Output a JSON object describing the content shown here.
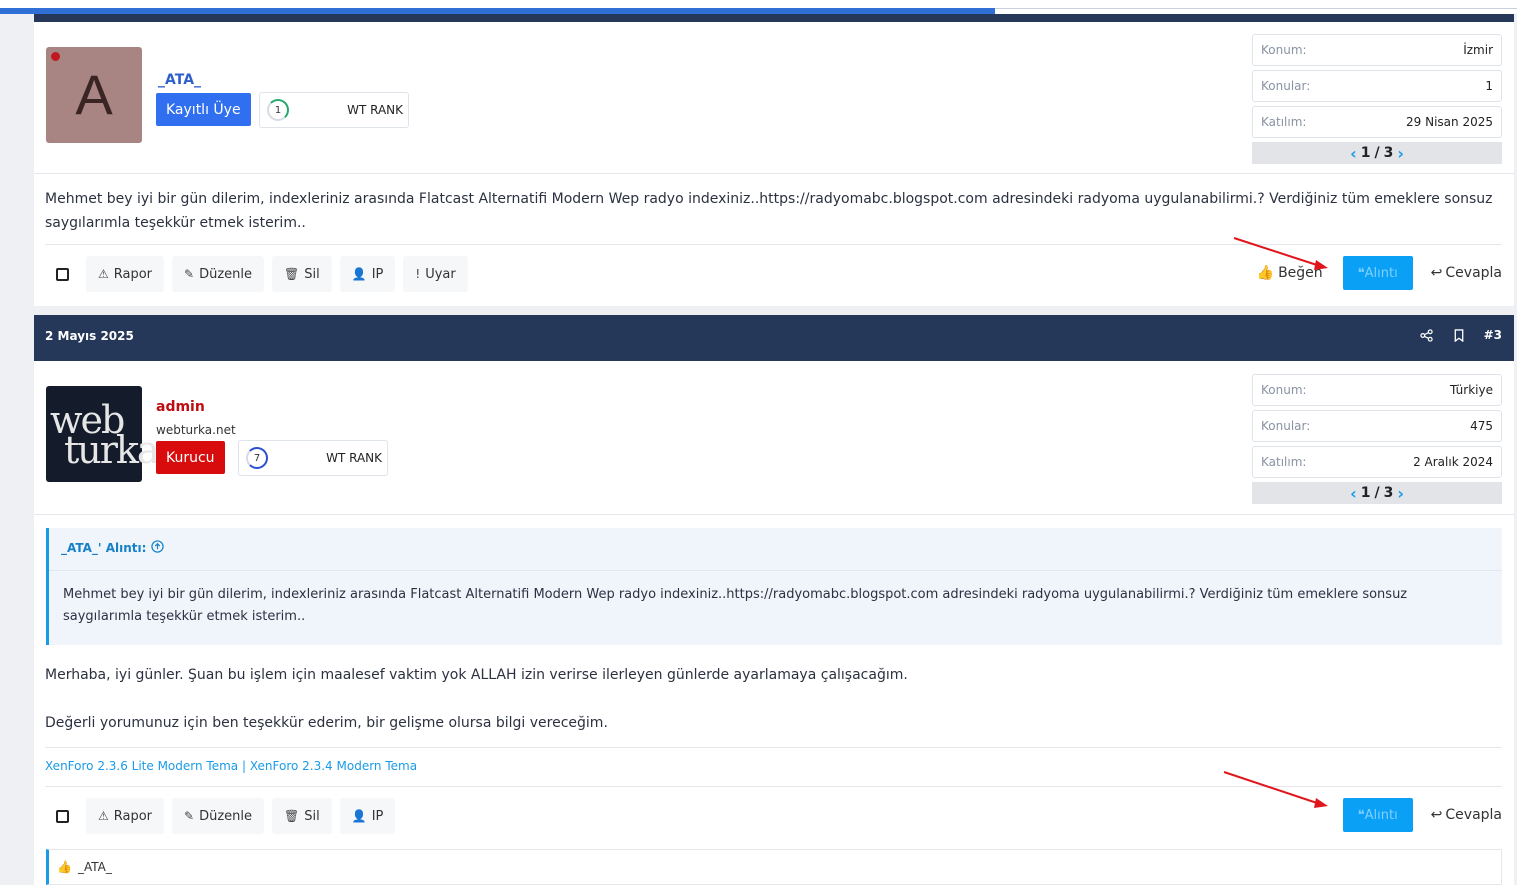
{
  "colors": {
    "header_bg": "#25385a",
    "accent": "#1a9be8",
    "quote_btn": "#0aa0f5",
    "role_member": "#2f6ff0",
    "role_founder": "#d80c0c",
    "arrow": "#e0161c"
  },
  "reading_progress_percent": 65.6,
  "post1": {
    "avatar_letter": "A",
    "username": "_ATA_",
    "role": "Kayıtlı Üye",
    "rank_number": "1",
    "rank_label": "WT RANK",
    "stats": [
      {
        "key": "Konum:",
        "value": "İzmir"
      },
      {
        "key": "Konular:",
        "value": "1"
      },
      {
        "key": "Katılım:",
        "value": "29 Nisan 2025"
      }
    ],
    "pager": {
      "current": "1",
      "sep": "/",
      "total": "3"
    },
    "body": "Mehmet bey iyi bir gün dilerim, indexleriniz arasında Flatcast Alternatifi Modern Wep radyo indexiniz..https://radyomabc.blogspot.com adresindeki radyoma uygulanabilirmi.? Verdiğiniz tüm emeklere sonsuz saygılarımla teşekkür etmek isterim..",
    "actions": {
      "report": "Rapor",
      "edit": "Düzenle",
      "delete": "Sil",
      "ip": "IP",
      "warn": "Uyar",
      "like": "Beğen",
      "quote": "Alıntı",
      "reply": "Cevapla"
    }
  },
  "post2": {
    "date": "2 Mayıs 2025",
    "post_number": "#3",
    "avatar_line1": "web",
    "avatar_line2": "turka",
    "username": "admin",
    "user_title": "webturka.net",
    "role": "Kurucu",
    "rank_number": "7",
    "rank_label": "WT RANK",
    "stats": [
      {
        "key": "Konum:",
        "value": "Türkiye"
      },
      {
        "key": "Konular:",
        "value": "475"
      },
      {
        "key": "Katılım:",
        "value": "2 Aralık 2024"
      }
    ],
    "pager": {
      "current": "1",
      "sep": "/",
      "total": "3"
    },
    "quote_author": "_ATA_' Alıntı:",
    "quote_text": "Mehmet bey iyi bir gün dilerim, indexleriniz arasında Flatcast Alternatifi Modern Wep radyo indexiniz..https://radyomabc.blogspot.com adresindeki radyoma uygulanabilirmi.? Verdiğiniz tüm emeklere sonsuz saygılarımla teşekkür etmek isterim..",
    "reply_line1": "Merhaba, iyi günler. Şuan bu işlem için maalesef vaktim yok ALLAH izin verirse ilerleyen günlerde ayarlamaya çalışacağım.",
    "reply_line2": "Değerli yorumunuz için ben teşekkür ederim, bir gelişme olursa bilgi vereceğim.",
    "signature_link1": "XenForo 2.3.6 Lite Modern Tema",
    "signature_sep": "|",
    "signature_link2": "XenForo 2.3.4 Modern Tema",
    "actions": {
      "report": "Rapor",
      "edit": "Düzenle",
      "delete": "Sil",
      "ip": "IP",
      "quote": "Alıntı",
      "reply": "Cevapla"
    },
    "reaction_user": "_ATA_"
  }
}
